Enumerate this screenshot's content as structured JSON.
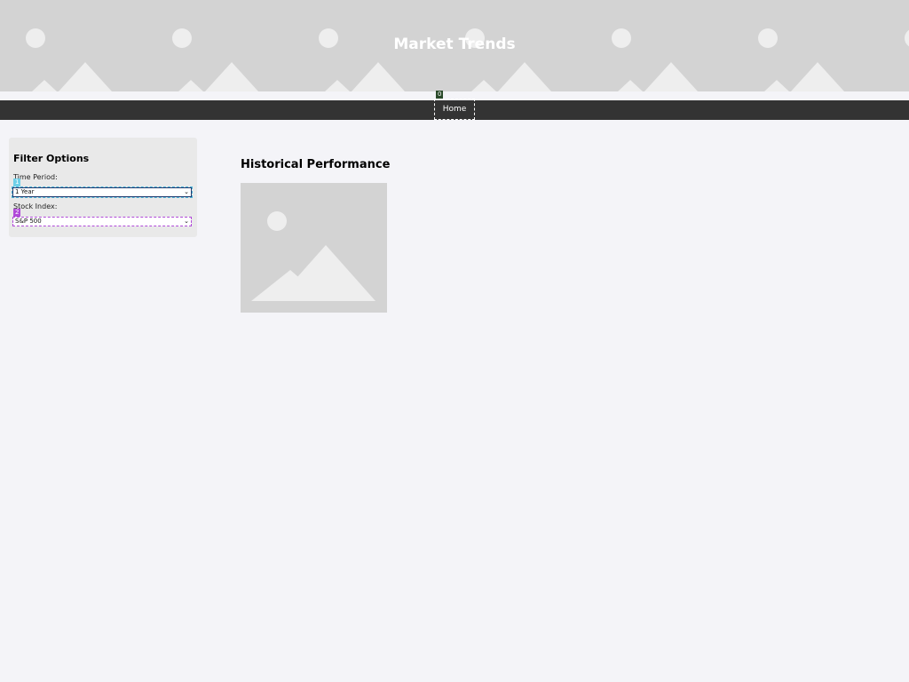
{
  "header": {
    "title": "Market Trends"
  },
  "nav": {
    "items": [
      {
        "label": "Home"
      }
    ]
  },
  "markers": [
    "0",
    "1",
    "2"
  ],
  "sidebar": {
    "title": "Filter Options",
    "fields": [
      {
        "label": "Time Period:",
        "selected": "1 Year"
      },
      {
        "label": "Stock Index:",
        "selected": "S&P 500"
      }
    ]
  },
  "main": {
    "title": "Historical Performance",
    "image_icon": "image-placeholder-icon"
  },
  "colors": {
    "background": "#f4f4f8",
    "header_bg": "#d3d3d3",
    "navbar_bg": "#333333",
    "sidebar_bg": "#e9e9e9"
  }
}
